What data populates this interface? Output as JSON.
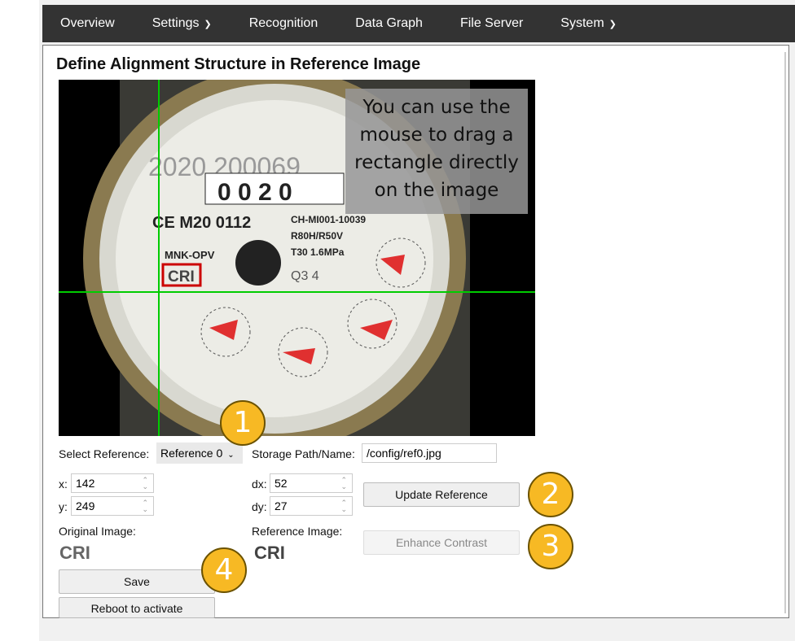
{
  "nav": {
    "items": [
      {
        "label": "Overview"
      },
      {
        "label": "Settings",
        "chevron": true
      },
      {
        "label": "Recognition"
      },
      {
        "label": "Data Graph"
      },
      {
        "label": "File Server"
      },
      {
        "label": "System",
        "chevron": true
      }
    ]
  },
  "page": {
    "title": "Define Alignment Structure in Reference Image"
  },
  "image": {
    "tooltip": "You can use the mouse to drag a rectangle directly on the image",
    "meter_text": {
      "serial": "2020 200069",
      "reading": "0 0 2 0",
      "ce": "CE M20 0112",
      "model": "CH-MI001-10039",
      "r": "R80H/R50V",
      "t": "T30 1.6MPa",
      "mnk": "MNK-OPV",
      "cri": "CRI",
      "q": "Q3 4"
    },
    "crosshair_color": "#00cc00",
    "selection_color": "#cc0000"
  },
  "form": {
    "select_reference_label": "Select Reference:",
    "select_reference_value": "Reference 0",
    "storage_label": "Storage Path/Name:",
    "storage_value": "/config/ref0.jpg",
    "x_label": "x:",
    "x_value": "142",
    "y_label": "y:",
    "y_value": "249",
    "dx_label": "dx:",
    "dx_value": "52",
    "dy_label": "dy:",
    "dy_value": "27",
    "update_button": "Update Reference",
    "enhance_button": "Enhance Contrast",
    "original_label": "Original Image:",
    "reference_label": "Reference Image:",
    "original_preview": "CRI",
    "reference_preview": "CRI",
    "save_button": "Save",
    "reboot_button": "Reboot to activate"
  },
  "badges": [
    "1",
    "2",
    "3",
    "4"
  ],
  "colors": {
    "badge": "#f7b924",
    "nav": "#333333"
  }
}
